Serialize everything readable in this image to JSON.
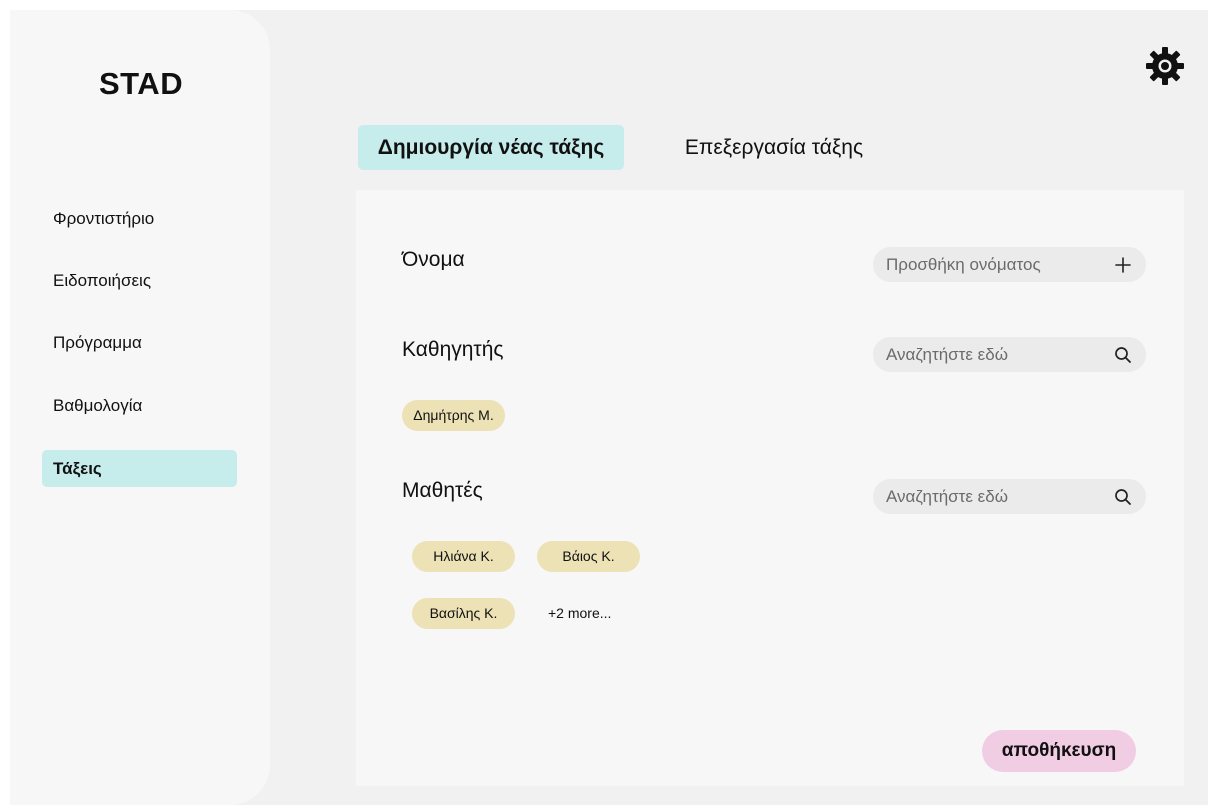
{
  "sidebar": {
    "logo": "STAD",
    "items": [
      {
        "label": "Φροντιστήριο"
      },
      {
        "label": "Ειδοποιήσεις"
      },
      {
        "label": "Πρόγραμμα"
      },
      {
        "label": "Βαθμολογία"
      },
      {
        "label": "Τάξεις",
        "active": true
      }
    ]
  },
  "tabs": [
    {
      "label": "Δημιουργία νέας τάξης",
      "active": true
    },
    {
      "label": "Επεξεργασία τάξης",
      "active": false
    }
  ],
  "form": {
    "name": {
      "label": "Όνομα",
      "placeholder": "Προσθήκη ονόματος",
      "value": ""
    },
    "teacher": {
      "label": "Καθηγητής",
      "placeholder": "Αναζητήστε εδώ",
      "value": "",
      "chips": [
        "Δημήτρης Μ."
      ]
    },
    "students": {
      "label": "Μαθητές",
      "placeholder": "Αναζητήστε εδώ",
      "value": "",
      "chips": [
        "Ηλιάνα Κ.",
        "Βάιος Κ.",
        "Βασίλης Κ."
      ],
      "more": "+2 more..."
    }
  },
  "save_label": "αποθήκευση",
  "icons": {
    "settings": "gear-icon",
    "add": "plus-icon",
    "search": "search-icon"
  },
  "colors": {
    "accent": "#c7ecec",
    "chip": "#ece2b6",
    "save": "#f1cde4"
  }
}
